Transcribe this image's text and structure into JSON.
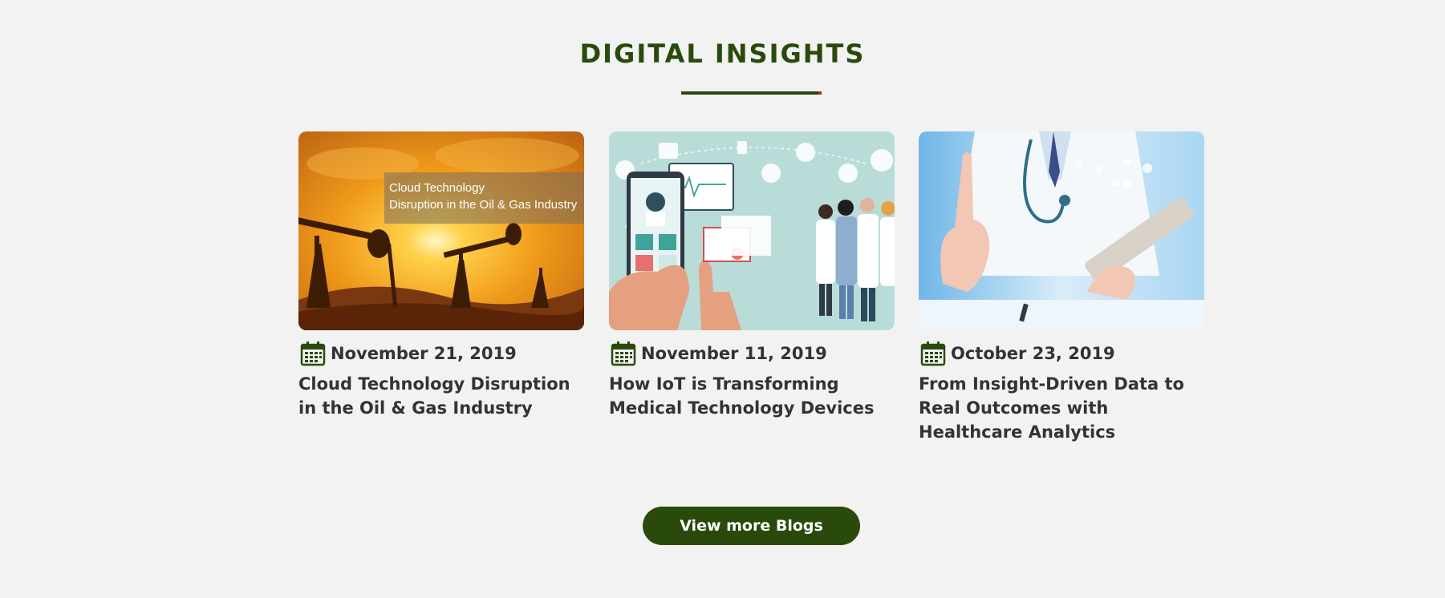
{
  "section": {
    "title": "DIGITAL INSIGHTS"
  },
  "colors": {
    "brand_green": "#2a4a0c",
    "accent_red": "#c0231e",
    "text_dark": "#333333",
    "background": "#f2f2f2"
  },
  "cards": [
    {
      "image_icon": "oil-pumpjack-sunset-image",
      "image_caption_line1": "Cloud Technology",
      "image_caption_line2": "Disruption in the Oil & Gas Industry",
      "date_icon": "calendar-icon",
      "date": "November 21, 2019",
      "title": "Cloud Technology Disruption in the Oil & Gas Industry"
    },
    {
      "image_icon": "iot-medical-devices-illustration",
      "date_icon": "calendar-icon",
      "date": "November 11, 2019",
      "title": "How IoT is Transforming Medical Technology Devices"
    },
    {
      "image_icon": "doctor-tablet-analytics-image",
      "date_icon": "calendar-icon",
      "date": "October 23, 2019",
      "title": "From Insight-Driven Data to Real Outcomes with Healthcare Analytics"
    }
  ],
  "cta": {
    "label": "View more Blogs"
  }
}
